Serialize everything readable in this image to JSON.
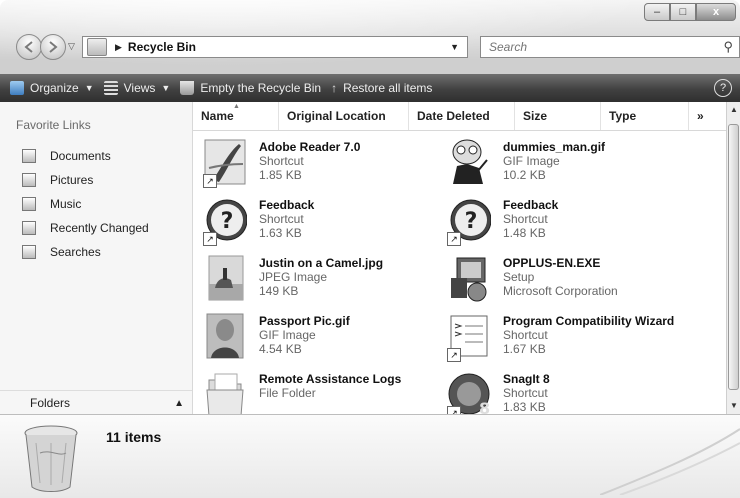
{
  "window": {
    "caption": {
      "min": "–",
      "max": "□",
      "close": "x"
    }
  },
  "address": {
    "location": "Recycle Bin",
    "search_placeholder": "Search"
  },
  "toolbar": {
    "organize": "Organize",
    "views": "Views",
    "empty": "Empty the Recycle Bin",
    "restore": "Restore all items",
    "help": "?"
  },
  "sidebar": {
    "title": "Favorite Links",
    "items": [
      {
        "label": "Documents"
      },
      {
        "label": "Pictures"
      },
      {
        "label": "Music"
      },
      {
        "label": "Recently Changed"
      },
      {
        "label": "Searches"
      }
    ],
    "folders": "Folders"
  },
  "columns": [
    "Name",
    "Original Location",
    "Date Deleted",
    "Size",
    "Type",
    "»"
  ],
  "files": [
    {
      "name": "Adobe Reader 7.0",
      "type": "Shortcut",
      "size": "1.85 KB"
    },
    {
      "name": "dummies_man.gif",
      "type": "GIF Image",
      "size": "10.2 KB"
    },
    {
      "name": "Feedback",
      "type": "Shortcut",
      "size": "1.63 KB"
    },
    {
      "name": "Feedback",
      "type": "Shortcut",
      "size": "1.48 KB"
    },
    {
      "name": "Justin on a Camel.jpg",
      "type": "JPEG Image",
      "size": "149 KB"
    },
    {
      "name": "OPPLUS-EN.EXE",
      "type": "Setup",
      "size": "Microsoft Corporation"
    },
    {
      "name": "Passport Pic.gif",
      "type": "GIF Image",
      "size": "4.54 KB"
    },
    {
      "name": "Program Compatibility Wizard",
      "type": "Shortcut",
      "size": "1.67 KB"
    },
    {
      "name": "Remote Assistance Logs",
      "type": "File Folder",
      "size": ""
    },
    {
      "name": "SnagIt 8",
      "type": "Shortcut",
      "size": "1.83 KB"
    }
  ],
  "details": {
    "count": "11 items"
  }
}
